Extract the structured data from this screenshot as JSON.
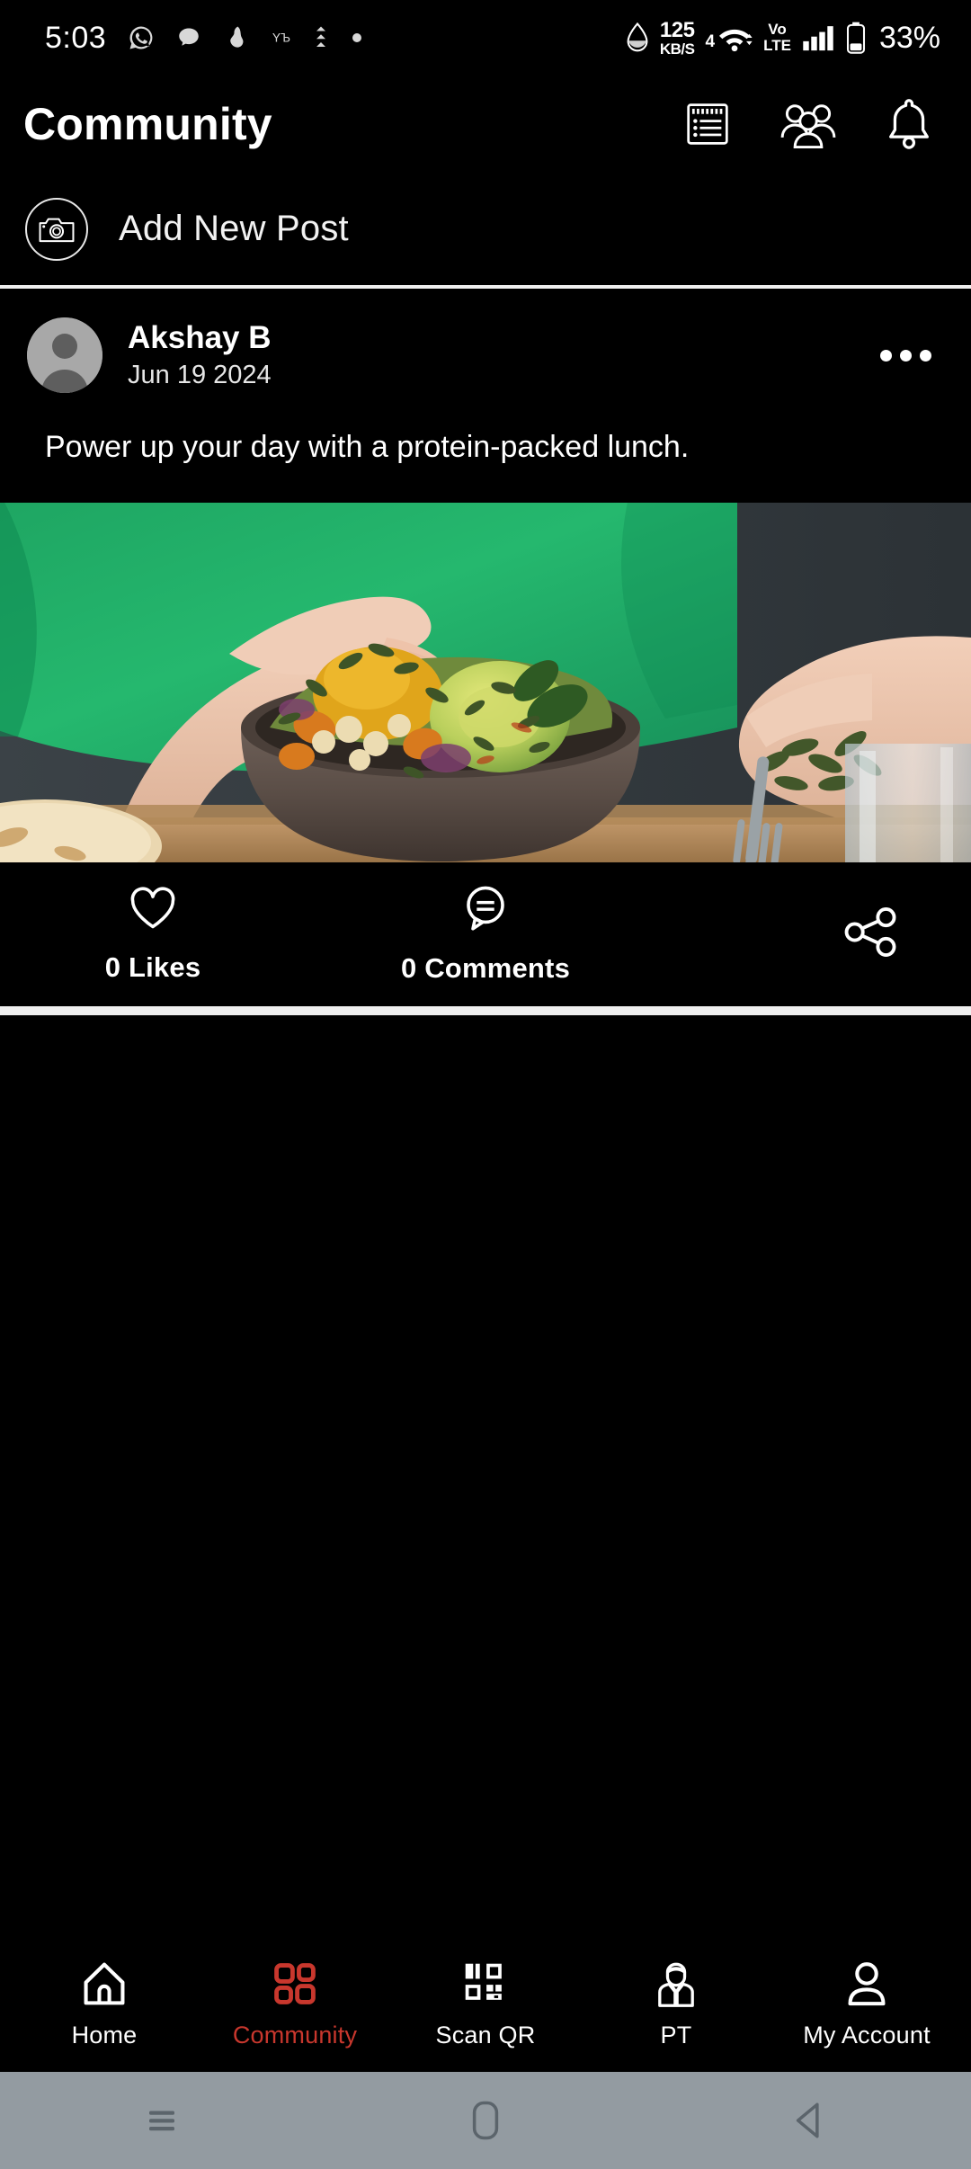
{
  "status_bar": {
    "time": "5:03",
    "left_icons": [
      "whatsapp-icon",
      "chat-bubble-icon",
      "notification-blob-icon",
      "yl-icon",
      "download-arrows-icon",
      "dot-icon"
    ],
    "network_speed_value": "125",
    "network_speed_unit": "KB/S",
    "water_drop_icon": "water-drop-icon",
    "wifi_generation": "4",
    "volte_top": "Vo",
    "volte_bottom": "LTE",
    "signal_icon": "signal-bars-icon",
    "battery_percent": "33%"
  },
  "header": {
    "title": "Community",
    "icons": [
      {
        "name": "notepad-list-icon",
        "label": "Notes"
      },
      {
        "name": "people-group-icon",
        "label": "Groups"
      },
      {
        "name": "bell-icon",
        "label": "Notifications"
      }
    ]
  },
  "add_post": {
    "icon": "camera-icon",
    "label": "Add New Post"
  },
  "post": {
    "avatar_icon": "avatar-placeholder-icon",
    "author": "Akshay B",
    "date": "Jun 19 2024",
    "menu_icon": "more-options-icon",
    "text": "Power up your day with a protein-packed lunch.",
    "image_alt": "person sprinkling pumpkin seeds over a vegetable salad bowl",
    "likes_label": "0 Likes",
    "likes_icon": "heart-outline-icon",
    "comments_label": "0 Comments",
    "comments_icon": "comment-bubble-icon",
    "share_icon": "share-icon"
  },
  "bottom_nav": {
    "active_color": "#c8372d",
    "items": [
      {
        "label": "Home",
        "icon": "home-icon",
        "active": false
      },
      {
        "label": "Community",
        "icon": "grid-squares-icon",
        "active": true
      },
      {
        "label": "Scan QR",
        "icon": "qr-code-icon",
        "active": false
      },
      {
        "label": "PT",
        "icon": "trainer-person-icon",
        "active": false
      },
      {
        "label": "My Account",
        "icon": "user-account-icon",
        "active": false
      }
    ]
  },
  "system_nav": {
    "recents_icon": "recents-menu-icon",
    "home_icon": "home-pill-icon",
    "back_icon": "back-triangle-icon"
  }
}
